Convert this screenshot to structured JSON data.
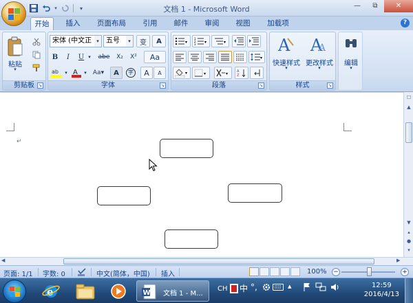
{
  "window": {
    "title": "文档 1 - Microsoft Word",
    "controls": {
      "minimize": "—",
      "restore": "⧉",
      "close": "✕"
    }
  },
  "quick_access": [
    "save-icon",
    "undo-icon",
    "redo-icon"
  ],
  "tabs": [
    {
      "label": "开始",
      "active": true
    },
    {
      "label": "插入"
    },
    {
      "label": "页面布局"
    },
    {
      "label": "引用"
    },
    {
      "label": "邮件"
    },
    {
      "label": "审阅"
    },
    {
      "label": "视图"
    },
    {
      "label": "加载项"
    }
  ],
  "ribbon": {
    "clipboard": {
      "group_label": "剪贴板",
      "paste_label": "粘贴"
    },
    "font": {
      "group_label": "字体",
      "font_name": "宋体 (中文正",
      "font_size": "五号",
      "bold": "B",
      "italic": "I",
      "underline": "U",
      "strike": "abe",
      "subscript": "X₂",
      "superscript": "X²",
      "grow": "A",
      "shrink": "A",
      "case": "Aa",
      "char_border": "A",
      "char_circle": "字",
      "phonetic": "变"
    },
    "paragraph": {
      "group_label": "段落"
    },
    "styles": {
      "group_label": "样式",
      "quick_styles": "快速样式",
      "change_styles": "更改样式"
    },
    "editing": {
      "label": "编辑"
    }
  },
  "document": {
    "paragraph_mark": "↵",
    "shapes": [
      "rounded-rect-top",
      "rounded-rect-left",
      "rounded-rect-right",
      "rounded-rect-bottom"
    ]
  },
  "statusbar": {
    "page": "页面: 1/1",
    "words": "字数: 0",
    "language": "中文(简体，中国)",
    "mode": "插入",
    "zoom": "100%"
  },
  "taskbar": {
    "word_button": "文档 1 - M...",
    "tray_lang": "CH",
    "tray_ime": "中",
    "time": "12:59",
    "date": "2016/4/13"
  }
}
